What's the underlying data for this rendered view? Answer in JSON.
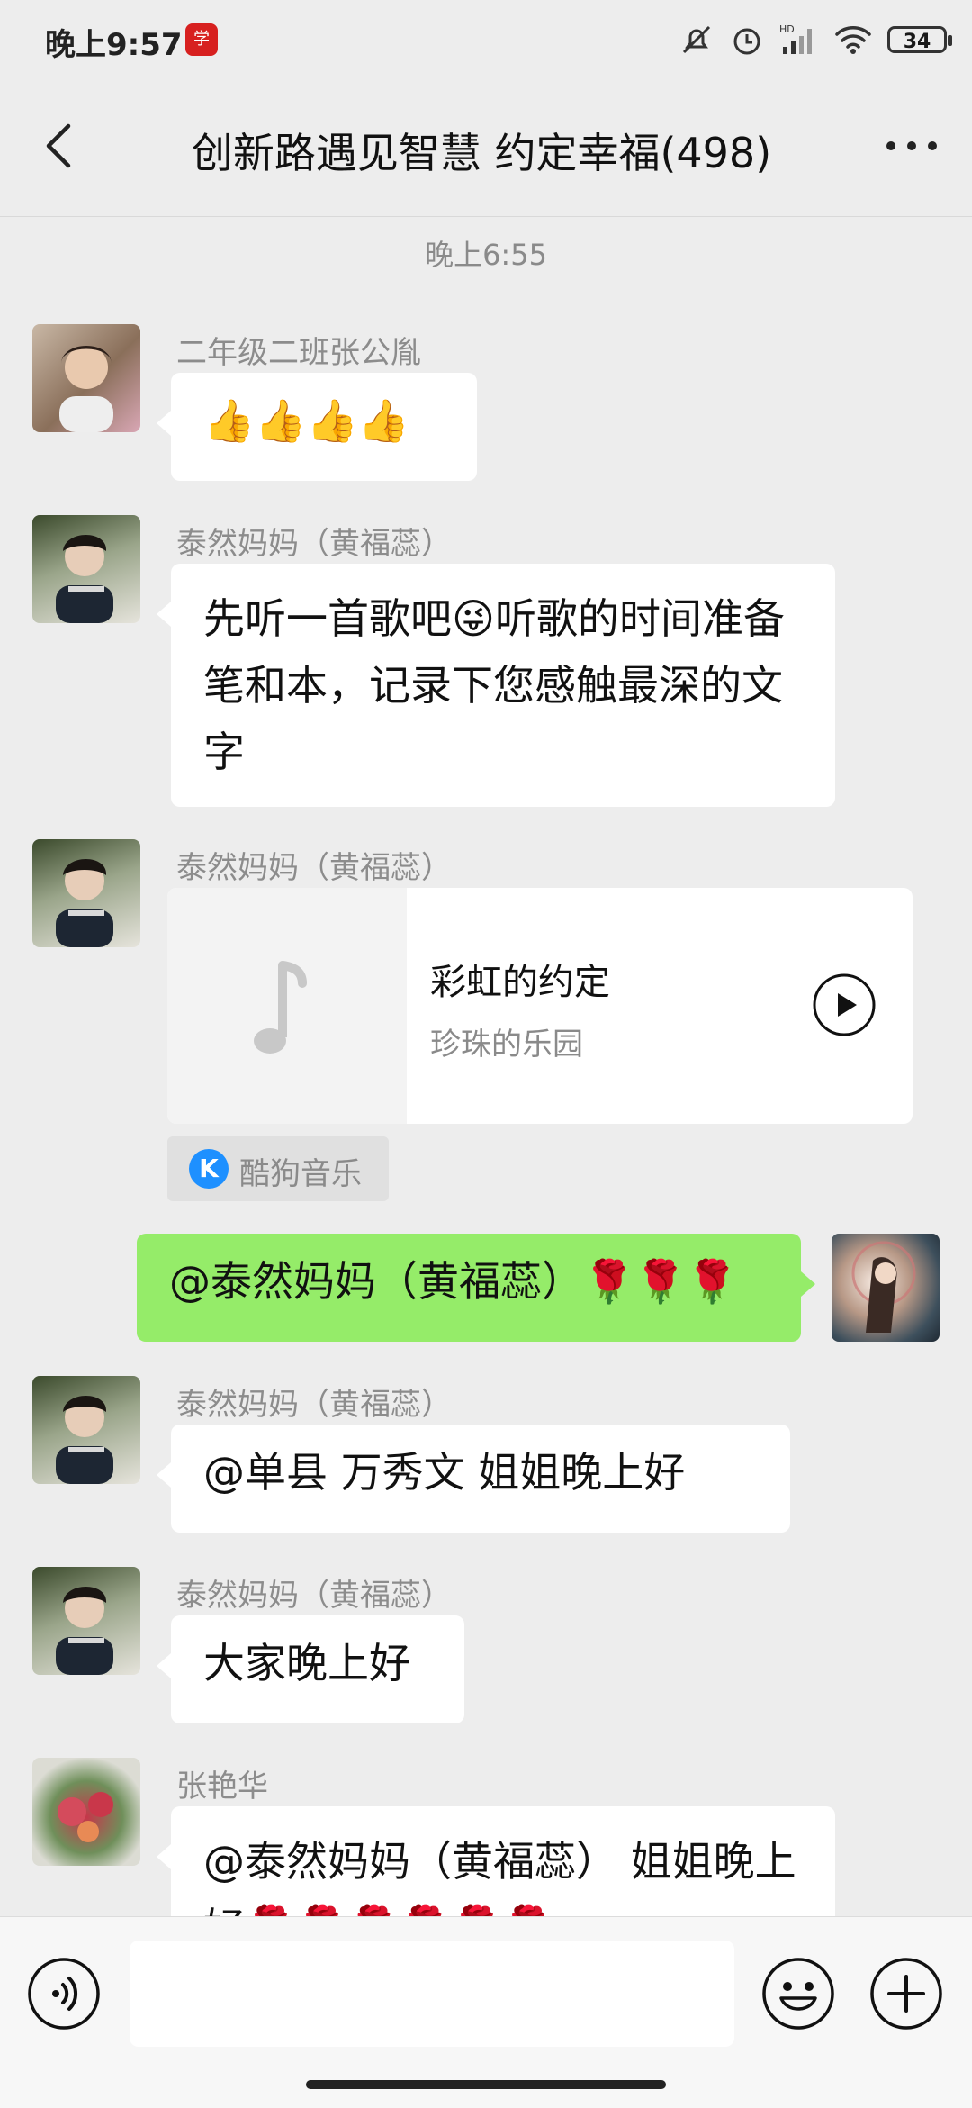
{
  "status_bar": {
    "time": "晚上9:57",
    "battery": "34"
  },
  "header": {
    "title": "创新路遇见智慧  约定幸福(498)"
  },
  "chat": {
    "timestamp": "晚上6:55",
    "messages": [
      {
        "sender": "二年级二班张公胤",
        "text": "👍👍👍👍"
      },
      {
        "sender": "泰然妈妈（黄福蕊）",
        "text": "先听一首歌吧😜听歌的时间准备笔和本，记录下您感触最深的文字"
      },
      {
        "sender": "泰然妈妈（黄福蕊）",
        "music": {
          "title": "彩虹的约定",
          "artist": "珍珠的乐园",
          "source": "酷狗音乐"
        }
      },
      {
        "sender": "me",
        "text": "@泰然妈妈（黄福蕊）🌹🌹🌹"
      },
      {
        "sender": "泰然妈妈（黄福蕊）",
        "text": "@单县  万秀文  姐姐晚上好"
      },
      {
        "sender": "泰然妈妈（黄福蕊）",
        "text": "大家晚上好"
      },
      {
        "sender": "张艳华",
        "text": "@泰然妈妈（黄福蕊） 姐姐晚上好🌹🌹🌹🌹🌹🌹"
      }
    ]
  },
  "icons": {
    "back": "chevron-left-icon",
    "more": "more-dots-icon",
    "voice": "voice-icon",
    "emoji": "emoji-icon",
    "plus": "plus-icon",
    "play": "play-icon",
    "music_note": "music-note-icon"
  },
  "colors": {
    "background": "#EDEDED",
    "bubble_self": "#95EC69",
    "bubble_other": "#FFFFFF"
  }
}
